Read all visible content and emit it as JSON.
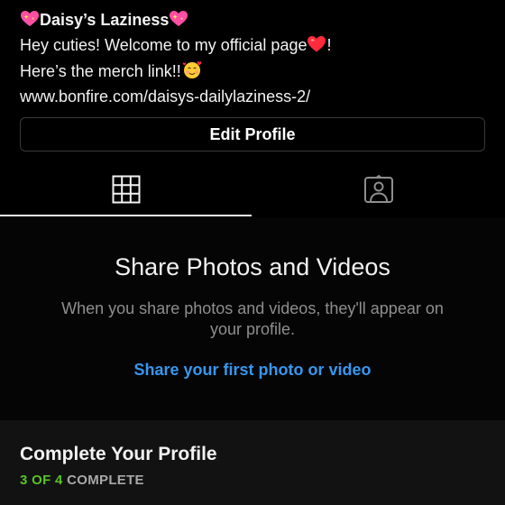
{
  "profile": {
    "bio": {
      "name_prefix_icon": "sparkling-heart-emoji",
      "name": "Daisy’s Laziness",
      "name_suffix_icon": "sparkling-heart-emoji",
      "line2_text": "Hey cuties! Welcome to my official page",
      "line2_icon": "red-heart-emoji",
      "line2_end": "!",
      "line3_text": "Here’s the merch link!!",
      "line3_icon": "smiling-face-with-hearts-emoji",
      "link": "www.bonfire.com/daisys-dailylaziness-2/"
    },
    "edit_button_label": "Edit Profile"
  },
  "tabs": [
    {
      "name": "posts-grid",
      "icon": "grid-icon",
      "active": true
    },
    {
      "name": "tagged",
      "icon": "tagged-person-icon",
      "active": false
    }
  ],
  "empty_state": {
    "title": "Share Photos and Videos",
    "subtitle": "When you share photos and videos, they'll appear on your profile.",
    "link_label": "Share your first photo or video"
  },
  "complete_profile": {
    "title": "Complete Your Profile",
    "progress_done": "3 OF 4",
    "progress_rest": " COMPLETE",
    "progress_fraction": 0.75
  },
  "colors": {
    "background": "#000000",
    "link_blue": "#3797f0",
    "progress_green": "#58c322",
    "muted_text": "#8e8e8e",
    "heart_pink": "#ff4fa3",
    "heart_red": "#ff2b3a"
  }
}
